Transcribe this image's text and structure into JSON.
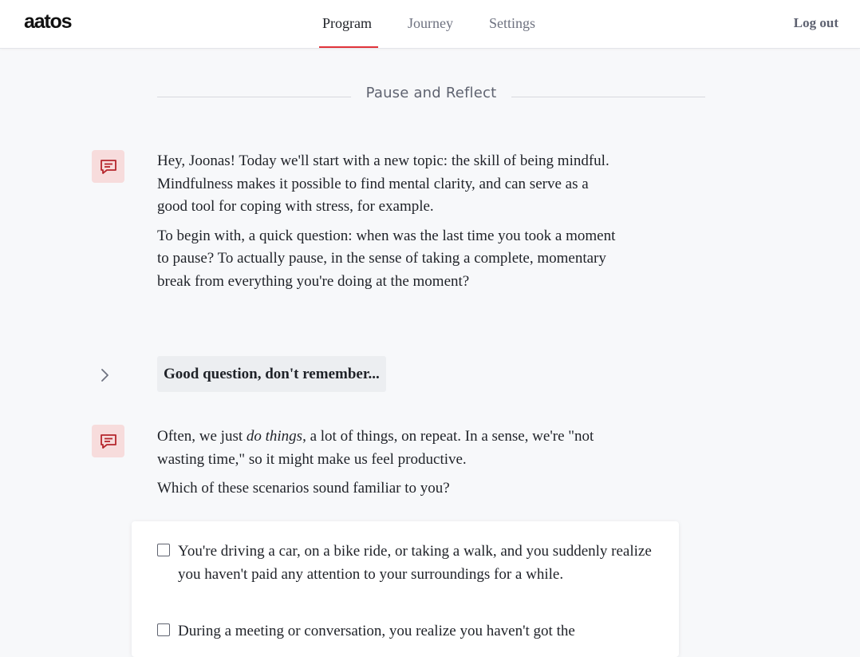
{
  "header": {
    "logo": "aatos",
    "tabs": [
      {
        "label": "Program",
        "active": true
      },
      {
        "label": "Journey",
        "active": false
      },
      {
        "label": "Settings",
        "active": false
      }
    ],
    "logout_label": "Log out",
    "accent_color": "#e0343a"
  },
  "section": {
    "title": "Pause and Reflect"
  },
  "messages": [
    {
      "paragraphs": [
        "Hey, Joonas! Today we'll start with a new topic: the skill of being mindful. Mindfulness makes it possible to find mental clarity, and can serve as a good tool for coping with stress, for example.",
        "To begin with, a quick question: when was the last time you took a moment to pause? To actually pause, in the sense of taking a complete, momentary break from everything you're doing at the moment?"
      ]
    },
    {
      "p1_before": "Often, we just ",
      "p1_em": "do things",
      "p1_after": ", a lot of things, on repeat. In a sense, we're \"not wasting time,\" so it might make us feel productive.",
      "p2": "Which of these scenarios sound familiar to you?"
    }
  ],
  "user_reply": "Good question, don't remember...",
  "options": [
    "You're driving a car, on a bike ride, or taking a walk, and you suddenly realize you haven't paid any attention to your surroundings for a while.",
    "During a meeting or conversation, you realize you haven't got the"
  ],
  "icons": {
    "bot": "chat-message-icon",
    "reply": "chevron-right-icon"
  }
}
